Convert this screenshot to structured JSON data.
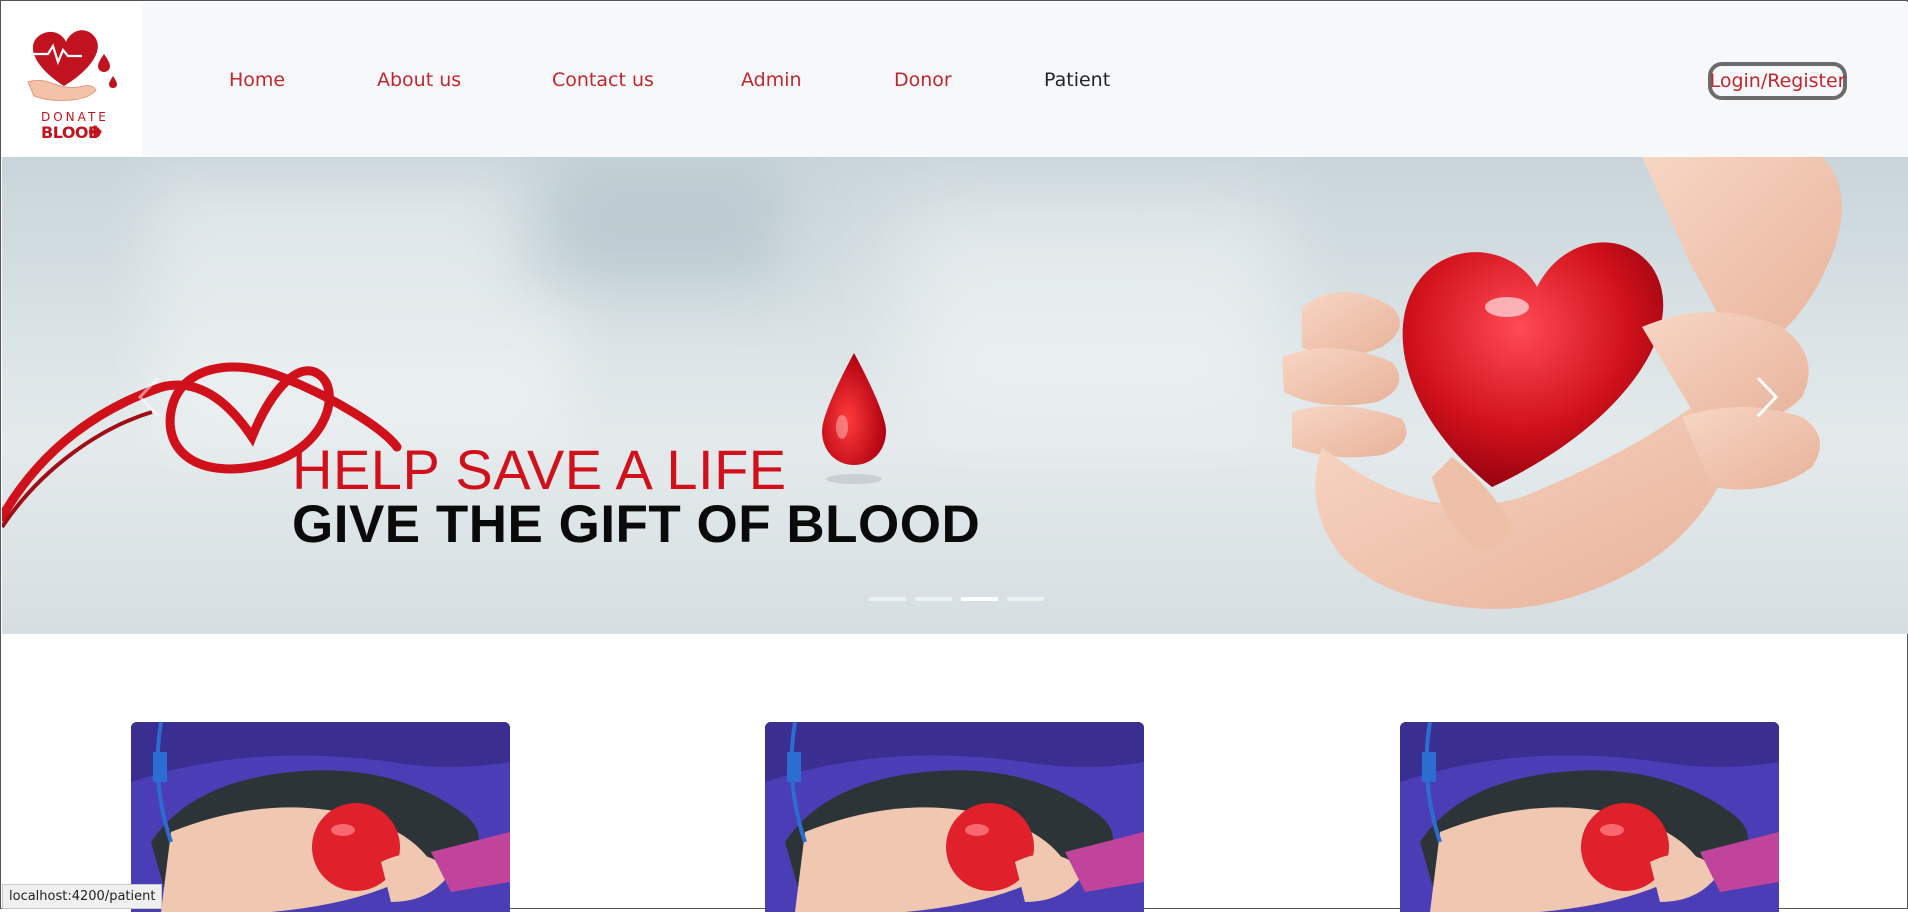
{
  "logo": {
    "line1": "DONATE",
    "line2": "BLOOD",
    "cross": "✚",
    "icon": "heart-hand-drop-logo"
  },
  "nav": {
    "items": [
      {
        "label": "Home",
        "active": false
      },
      {
        "label": "About us",
        "active": false
      },
      {
        "label": "Contact us",
        "active": false
      },
      {
        "label": "Admin",
        "active": false
      },
      {
        "label": "Donor",
        "active": false
      },
      {
        "label": "Patient",
        "active": true
      }
    ],
    "login_label": "Login/Register"
  },
  "hero": {
    "line1": "HELP SAVE A LIFE",
    "line2": "GIVE THE GIFT OF BLOOD",
    "slide_count": 4,
    "active_slide": 3,
    "prev_icon": "chevron-left-icon",
    "next_icon": "chevron-right-icon"
  },
  "cards": [
    {
      "image": "blood-donation-arm-with-red-ball"
    },
    {
      "image": "blood-donation-arm-with-red-ball"
    },
    {
      "image": "blood-donation-arm-with-red-ball"
    }
  ],
  "status_bar": {
    "url": "localhost:4200/patient"
  },
  "colors": {
    "brand_red": "#c1272d",
    "active_nav": "#212529",
    "navbar_bg": "#f7f8fa"
  }
}
